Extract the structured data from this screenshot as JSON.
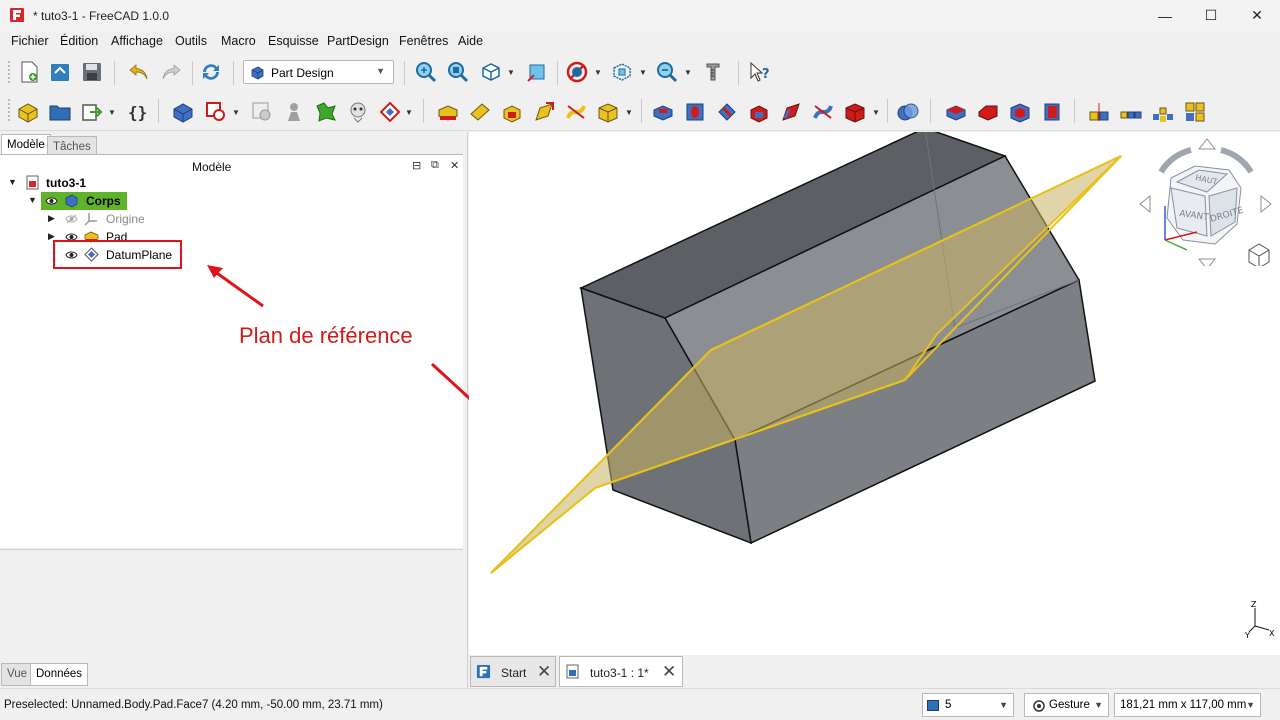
{
  "window": {
    "title": "* tuto3-1 - FreeCAD 1.0.0",
    "minimize": "—",
    "maximize": "☐",
    "close": "✕"
  },
  "menu": [
    "Fichier",
    "Édition",
    "Affichage",
    "Outils",
    "Macro",
    "Esquisse",
    "PartDesign",
    "Fenêtres",
    "Aide"
  ],
  "toolbar": {
    "workbench": "Part Design"
  },
  "left_panel": {
    "tabs": [
      "Modèle",
      "Tâches"
    ],
    "title": "Modèle",
    "tree": {
      "document": "tuto3-1",
      "body": "Corps",
      "origin": "Origine",
      "pad": "Pad",
      "datum": "DatumPlane"
    },
    "bottom_tabs": [
      "Vue",
      "Données"
    ]
  },
  "annotation": {
    "label": "Plan de référence",
    "color": "#d11a1a"
  },
  "navcube": {
    "top": "HAUT",
    "front": "AVANT",
    "right": "DROITE"
  },
  "axes": {
    "z": "Z",
    "y": "Y",
    "x": "X"
  },
  "doc_tabs": [
    {
      "label": "Start"
    },
    {
      "label": "tuto3-1 : 1*"
    }
  ],
  "status": {
    "preselected": "Preselected: Unnamed.Body.Pad.Face7 (4.20 mm, -50.00 mm, 23.71 mm)",
    "level": "5",
    "nav_style": "Gesture",
    "dimensions": "181,21 mm x 117,00 mm"
  },
  "colors": {
    "accent": "#5fb32a",
    "highlight": "#e0131a",
    "datum_plane": "#e6c21a"
  }
}
